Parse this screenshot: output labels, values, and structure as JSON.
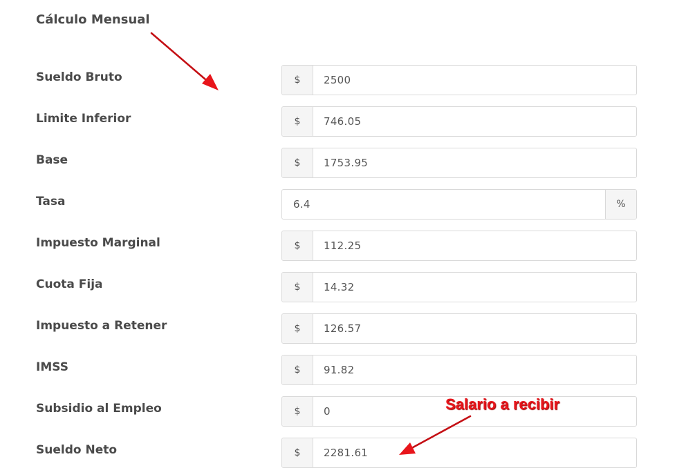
{
  "heading": "Cálculo Mensual",
  "rows": [
    {
      "label": "Sueldo Bruto",
      "addon": "$",
      "addon_position": "prefix",
      "value": "2500"
    },
    {
      "label": "Limite Inferior",
      "addon": "$",
      "addon_position": "prefix",
      "value": "746.05"
    },
    {
      "label": "Base",
      "addon": "$",
      "addon_position": "prefix",
      "value": "1753.95"
    },
    {
      "label": "Tasa",
      "addon": "%",
      "addon_position": "suffix",
      "value": "6.4"
    },
    {
      "label": "Impuesto Marginal",
      "addon": "$",
      "addon_position": "prefix",
      "value": "112.25"
    },
    {
      "label": "Cuota Fija",
      "addon": "$",
      "addon_position": "prefix",
      "value": "14.32"
    },
    {
      "label": "Impuesto a Retener",
      "addon": "$",
      "addon_position": "prefix",
      "value": "126.57"
    },
    {
      "label": "IMSS",
      "addon": "$",
      "addon_position": "prefix",
      "value": "91.82"
    },
    {
      "label": "Subsidio al Empleo",
      "addon": "$",
      "addon_position": "prefix",
      "value": "0"
    },
    {
      "label": "Sueldo Neto",
      "addon": "$",
      "addon_position": "prefix",
      "value": "2281.61"
    }
  ],
  "annotation": {
    "text": "Salario a recibir",
    "color": "#e8151b"
  },
  "icons": [
    "arrow-annotation-icon"
  ]
}
